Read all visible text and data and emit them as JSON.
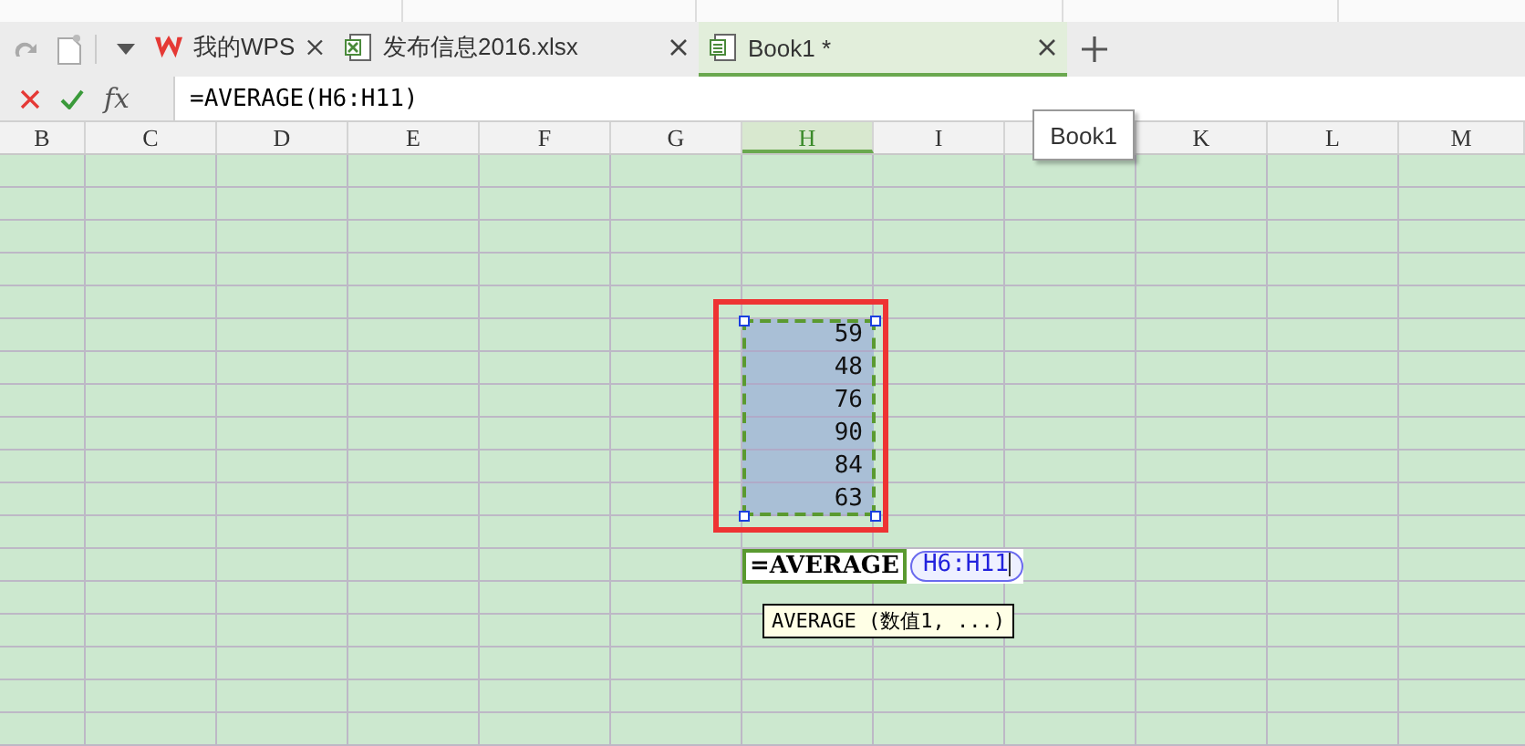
{
  "tabs": [
    {
      "label": "我的WPS",
      "kind": "home",
      "selected": false
    },
    {
      "label": "发布信息2016.xlsx",
      "kind": "sheet",
      "selected": false
    },
    {
      "label": "Book1 *",
      "kind": "book",
      "selected": true
    }
  ],
  "tab_tooltip": "Book1",
  "formula_bar": {
    "function_label": "fx",
    "formula": "=AVERAGE(H6:H11)"
  },
  "columns": [
    {
      "label": "B",
      "selected": false
    },
    {
      "label": "C",
      "selected": false
    },
    {
      "label": "D",
      "selected": false
    },
    {
      "label": "E",
      "selected": false
    },
    {
      "label": "F",
      "selected": false
    },
    {
      "label": "G",
      "selected": false
    },
    {
      "label": "H",
      "selected": true
    },
    {
      "label": "I",
      "selected": false
    },
    {
      "selected": false
    },
    {
      "label": "K",
      "selected": false
    },
    {
      "label": "L",
      "selected": false
    },
    {
      "label": "M",
      "selected": false
    }
  ],
  "selected_range": {
    "values": [
      "59",
      "48",
      "76",
      "90",
      "84",
      "63"
    ]
  },
  "editing_cell": {
    "text": "=AVERAGE",
    "reference": "H6:H11"
  },
  "function_hint": "AVERAGE (数值1, ...)"
}
